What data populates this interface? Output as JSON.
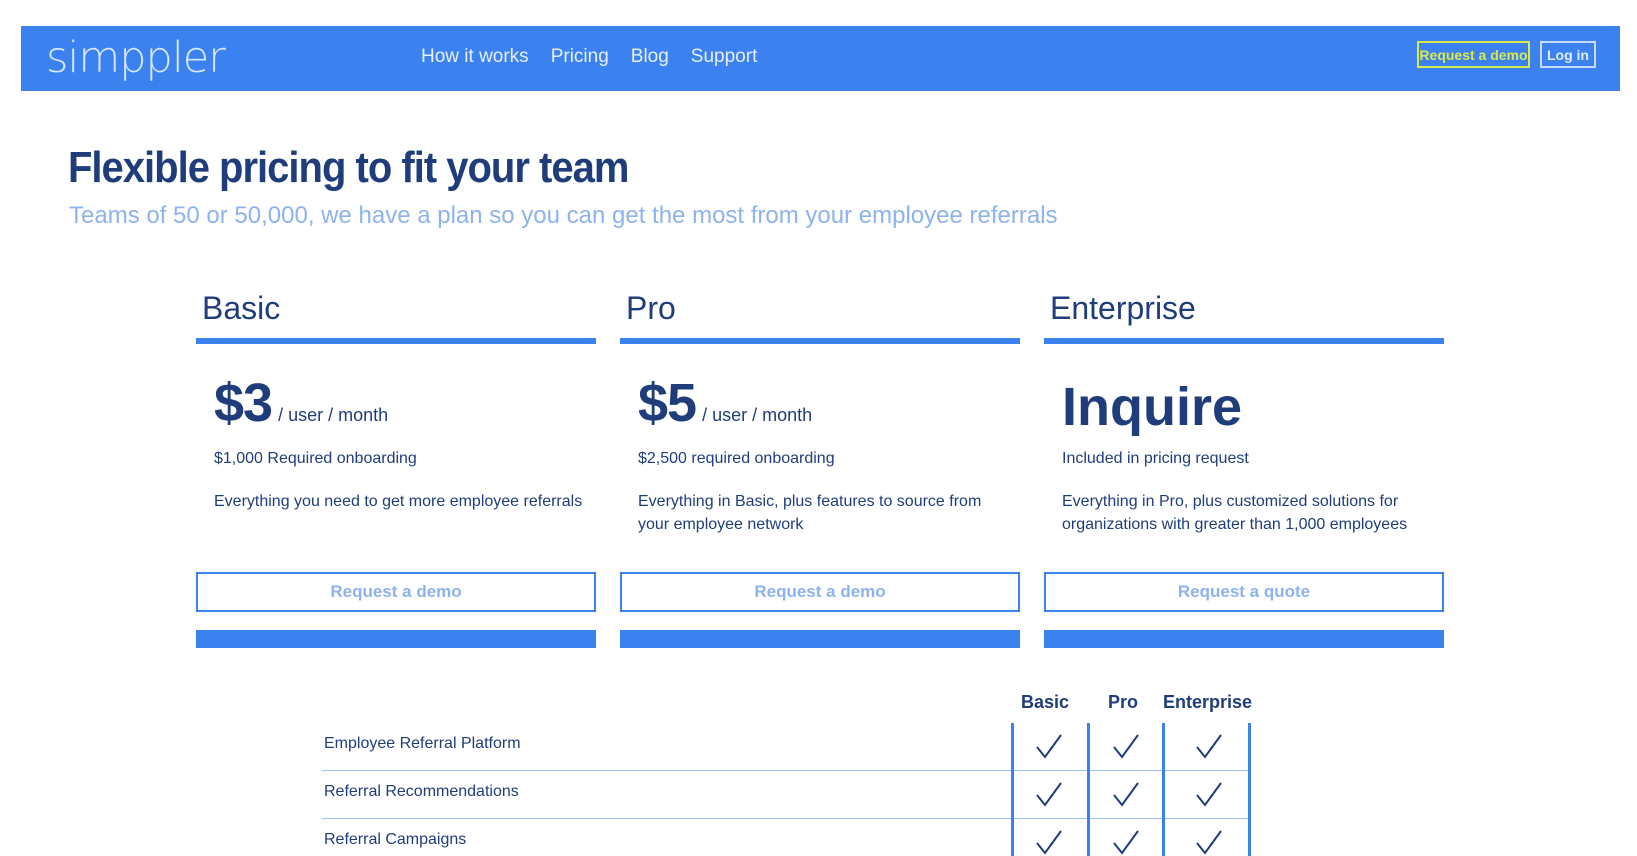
{
  "nav": {
    "logo": "simppler",
    "links": [
      "How it works",
      "Pricing",
      "Blog",
      "Support"
    ],
    "request_demo": "Request a demo",
    "login": "Log in"
  },
  "hero": {
    "title": "Flexible pricing to fit your team",
    "subtitle": "Teams of 50 or 50,000, we have a plan so you can get the most from your employee referrals"
  },
  "plans": [
    {
      "name": "Basic",
      "price": "$3",
      "unit": "/ user / month",
      "onboarding": "$1,000 Required onboarding",
      "description": "Everything you need to get more employee referrals",
      "button": "Request a demo"
    },
    {
      "name": "Pro",
      "price": "$5",
      "unit": "/ user / month",
      "onboarding": "$2,500 required onboarding",
      "description": "Everything in Basic, plus features to source from your employee network",
      "button": "Request a demo"
    },
    {
      "name": "Enterprise",
      "price": "Inquire",
      "unit": "",
      "onboarding": "Included in pricing request",
      "description": "Everything in Pro, plus customized solutions for organizations with greater than 1,000 employees",
      "button": "Request a quote"
    }
  ],
  "features": {
    "columns": [
      "Basic",
      "Pro",
      "Enterprise"
    ],
    "rows": [
      {
        "label": "Employee Referral Platform",
        "basic": true,
        "pro": true,
        "enterprise": true
      },
      {
        "label": "Referral Recommendations",
        "basic": true,
        "pro": true,
        "enterprise": true
      },
      {
        "label": "Referral Campaigns",
        "basic": true,
        "pro": true,
        "enterprise": true
      }
    ]
  },
  "colors": {
    "accent": "#3b82f0",
    "heading": "#1f3d7a",
    "subtitle": "#8db3ee",
    "demo_button": "#d9e94a"
  }
}
